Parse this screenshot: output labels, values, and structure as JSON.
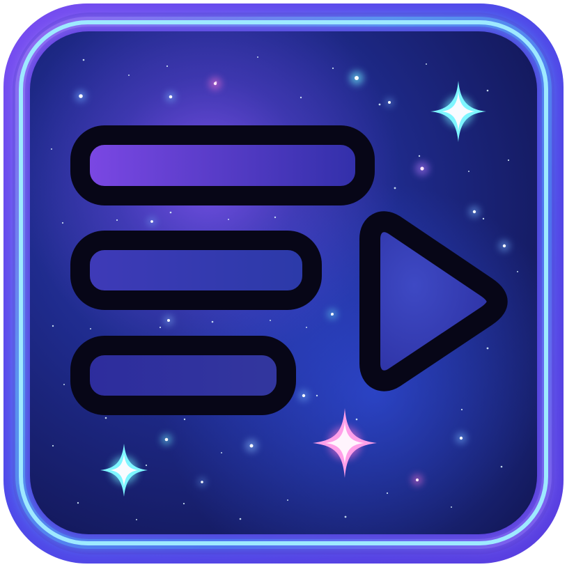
{
  "icon": {
    "name": "playlist-play-icon",
    "colors": {
      "frame_outer": "#6b49e8",
      "frame_glow_cyan": "#5fd8ff",
      "frame_glow_violet": "#a77bff",
      "space_deep": "#141b63",
      "space_mid": "#23309a",
      "space_violet": "#5a37c7",
      "outline": "#070617",
      "star_cyan": "#71f3ff",
      "star_blue": "#6da9ff",
      "star_pink": "#ff9fe8",
      "star_white": "#f8fbff"
    }
  }
}
